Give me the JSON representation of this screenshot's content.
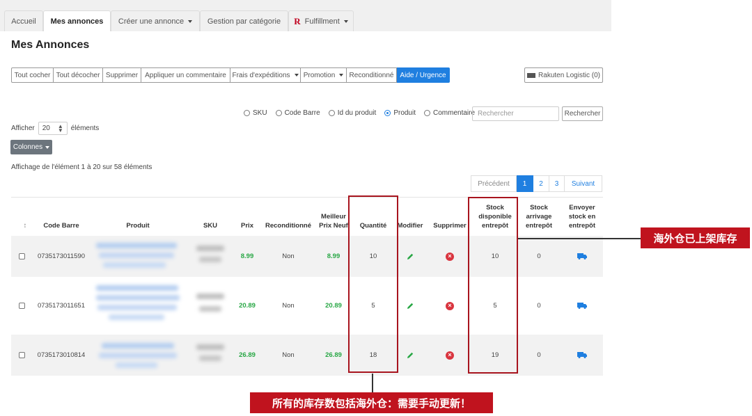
{
  "tabs": [
    {
      "label": "Accueil"
    },
    {
      "label": "Mes annonces"
    },
    {
      "label": "Créer une annonce"
    },
    {
      "label": "Gestion par catégorie"
    },
    {
      "label": "Fulfillment",
      "logo": "R"
    }
  ],
  "page_title": "Mes Annonces",
  "toolbar": {
    "buttons": [
      "Tout cocher",
      "Tout décocher",
      "Supprimer",
      "Appliquer un commentaire",
      "Frais d'expéditions",
      "Promotion",
      "Reconditionné",
      "Aide / Urgence"
    ],
    "rakuten_logistic": "Rakuten Logistic (0)"
  },
  "search": {
    "options": [
      "SKU",
      "Code Barre",
      "Id du produit",
      "Produit",
      "Commentaire"
    ],
    "selected": "Produit",
    "placeholder": "Rechercher",
    "button": "Rechercher"
  },
  "length": {
    "prefix": "Afficher",
    "value": "20",
    "suffix": "éléments"
  },
  "columns_button": "Colonnes",
  "info_text": "Affichage de l'élément 1 à 20 sur 58 éléments",
  "pagination": {
    "prev": "Précédent",
    "pages": [
      "1",
      "2",
      "3"
    ],
    "current": "1",
    "next": "Suivant"
  },
  "table": {
    "headers": {
      "sort": "↕",
      "barcode": "Code Barre",
      "product": "Produit",
      "sku": "SKU",
      "price": "Prix",
      "refurb": "Reconditionné",
      "best": "Meilleur Prix Neuf",
      "qty": "Quantité",
      "edit": "Modifier",
      "delete": "Supprimer",
      "stock_avail": "Stock disponible entrepôt",
      "stock_arrival": "Stock arrivage entrepôt",
      "send": "Envoyer stock en entrepôt"
    },
    "rows": [
      {
        "barcode": "0735173011590",
        "price": "8.99",
        "refurb": "Non",
        "best": "8.99",
        "qty": "10",
        "stock_avail": "10",
        "stock_arrival": "0"
      },
      {
        "barcode": "0735173011651",
        "price": "20.89",
        "refurb": "Non",
        "best": "20.89",
        "qty": "5",
        "stock_avail": "5",
        "stock_arrival": "0"
      },
      {
        "barcode": "0735173010814",
        "price": "26.89",
        "refurb": "Non",
        "best": "26.89",
        "qty": "18",
        "stock_avail": "19",
        "stock_arrival": "0"
      }
    ]
  },
  "annotations": {
    "right": "海外仓已上架库存",
    "bottom": "所有的库存数包括海外仓：需要手动更新！"
  },
  "colors": {
    "primary": "#1f7fe0",
    "highlight": "#a8141e",
    "callout": "#c0131e",
    "price_green": "#28a745"
  }
}
